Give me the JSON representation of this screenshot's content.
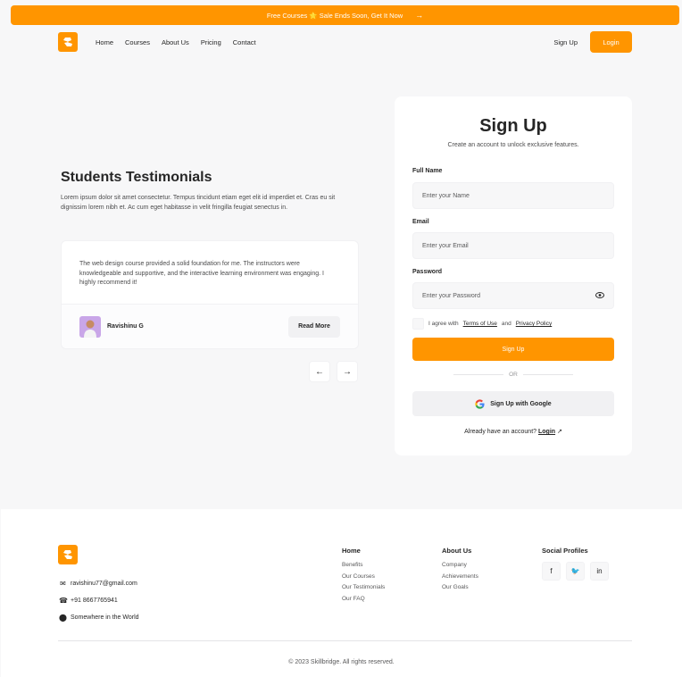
{
  "announcement": {
    "text": "Free Courses 🌟 Sale Ends Soon, Get It Now",
    "arrow": "→"
  },
  "nav": {
    "links": [
      "Home",
      "Courses",
      "About Us",
      "Pricing",
      "Contact"
    ],
    "signup": "Sign Up",
    "login": "Login"
  },
  "testimonials": {
    "title": "Students Testimonials",
    "description": "Lorem ipsum dolor sit amet consectetur. Tempus tincidunt etiam eget elit id imperdiet et. Cras eu sit dignissim lorem nibh et. Ac cum eget habitasse in velit fringilla feugiat senectus in.",
    "quote": "The web design course provided a solid foundation for me. The instructors were knowledgeable and supportive, and the interactive learning environment was engaging. I highly recommend it!",
    "author": "Ravishinu G",
    "read_more": "Read More",
    "prev": "←",
    "next": "→"
  },
  "signup_form": {
    "title": "Sign Up",
    "subtitle": "Create an account to unlock exclusive features.",
    "full_name_label": "Full Name",
    "full_name_placeholder": "Enter your Name",
    "email_label": "Email",
    "email_placeholder": "Enter your Email",
    "password_label": "Password",
    "password_placeholder": "Enter your Password",
    "agree_prefix": "I agree with",
    "terms": "Terms of Use",
    "agree_and": "and",
    "privacy": "Privacy Policy",
    "submit": "Sign Up",
    "or": "OR",
    "google": "Sign Up with Google",
    "already": "Already have an account?",
    "login": "Login"
  },
  "footer": {
    "email": "ravishinu77@gmail.com",
    "phone": "+91 8667765941",
    "location": "Somewhere in the World",
    "home": {
      "title": "Home",
      "items": [
        "Benefits",
        "Our Courses",
        "Our Testimonials",
        "Our FAQ"
      ]
    },
    "about": {
      "title": "About Us",
      "items": [
        "Company",
        "Achievements",
        "Our Goals"
      ]
    },
    "social": {
      "title": "Social Profiles"
    },
    "copyright": "© 2023 Skillbridge. All rights reserved."
  },
  "colors": {
    "accent": "#ff9500",
    "background": "#f7f7f8",
    "text": "#262626"
  }
}
